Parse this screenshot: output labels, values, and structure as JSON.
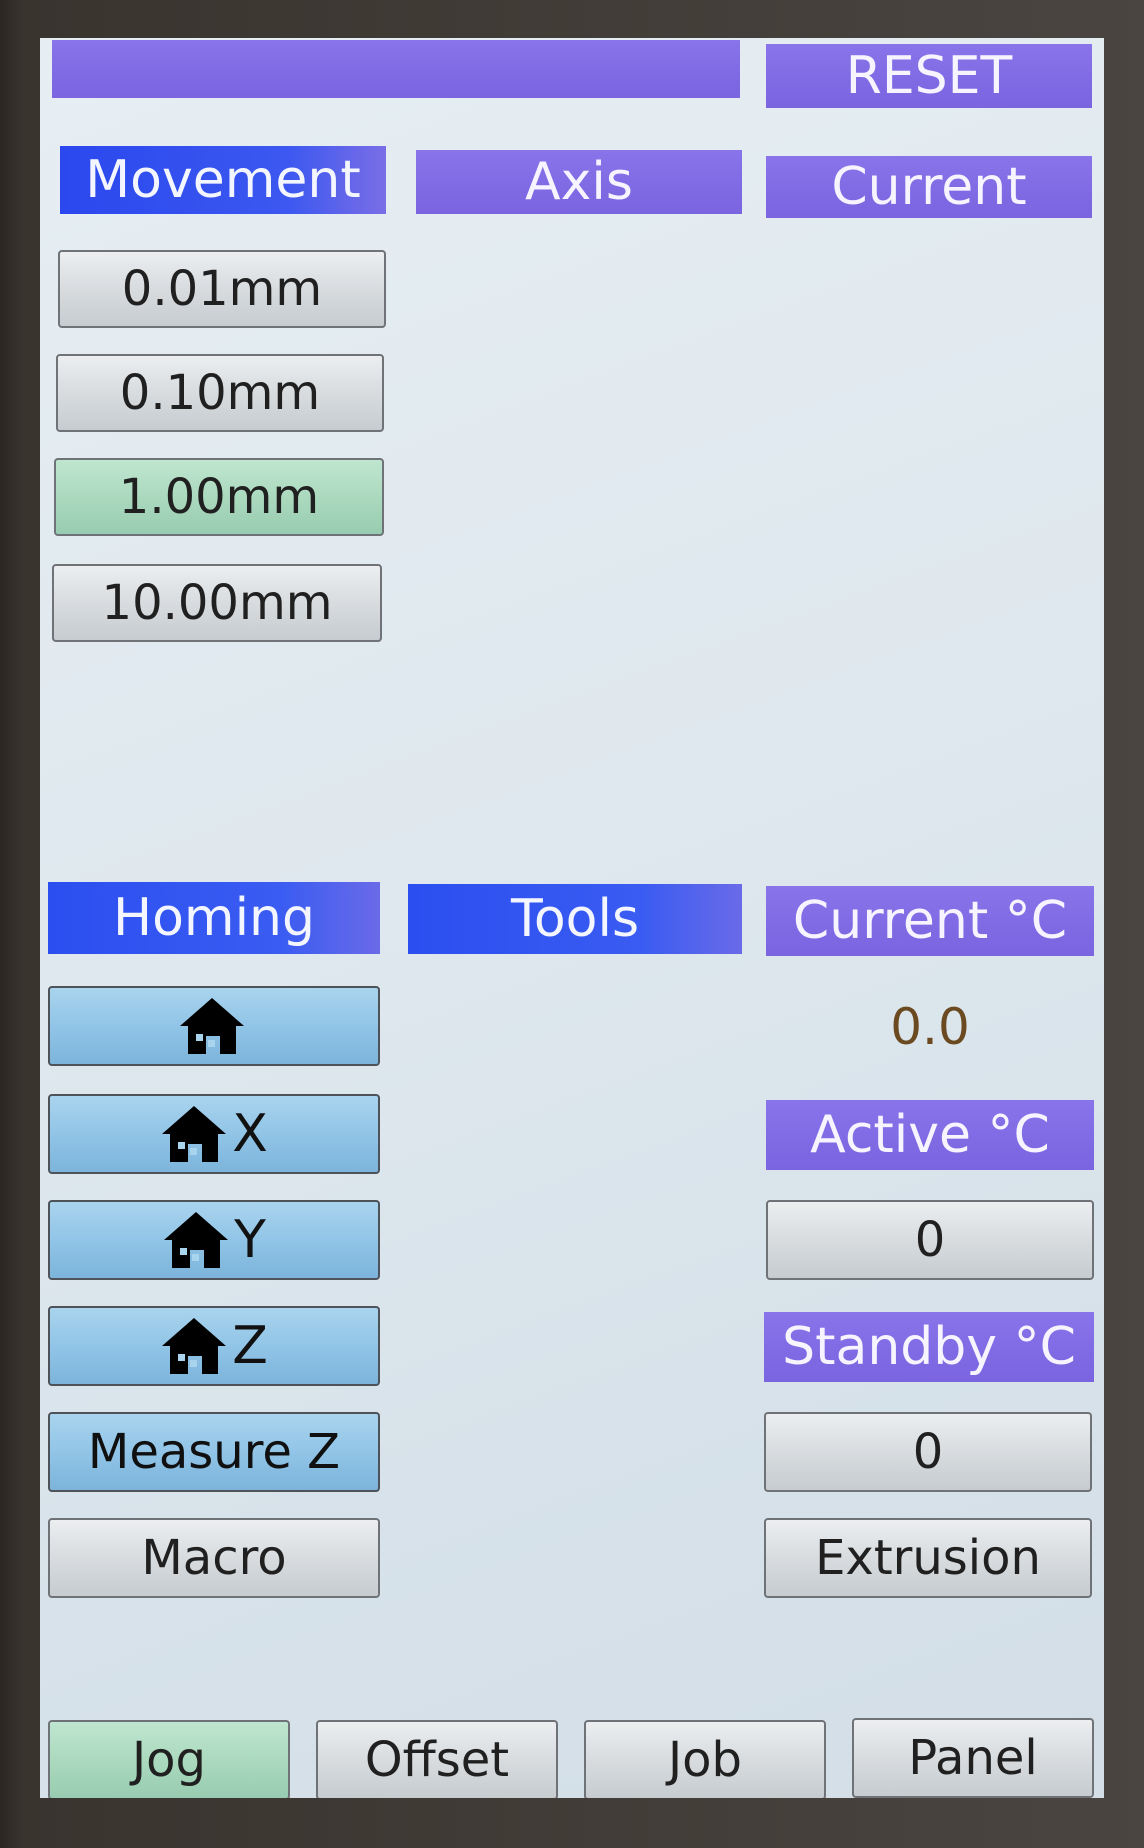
{
  "top": {
    "reset_label": "RESET"
  },
  "headers": {
    "movement": "Movement",
    "axis": "Axis",
    "current": "Current",
    "homing": "Homing",
    "tools": "Tools",
    "current_temp": "Current °C",
    "active_temp": "Active °C",
    "standby_temp": "Standby °C"
  },
  "movement_steps": [
    {
      "label": "0.01mm",
      "selected": false
    },
    {
      "label": "0.10mm",
      "selected": false
    },
    {
      "label": "1.00mm",
      "selected": true
    },
    {
      "label": "10.00mm",
      "selected": false
    }
  ],
  "homing": {
    "home_all_icon": "home-icon",
    "home_x": "X",
    "home_y": "Y",
    "home_z": "Z",
    "measure_z": "Measure  Z",
    "macro": "Macro"
  },
  "temps": {
    "current_value": "0.0",
    "active_value": "0",
    "standby_value": "0",
    "extrusion_label": "Extrusion"
  },
  "tabs": [
    {
      "label": "Jog",
      "active": true
    },
    {
      "label": "Offset",
      "active": false
    },
    {
      "label": "Job",
      "active": false
    },
    {
      "label": "Panel",
      "active": false
    }
  ],
  "colors": {
    "header_purple": "#7a64e0",
    "header_blue": "#2b4ef0",
    "selected_green": "#a9d8bd",
    "homing_blue": "#8fc3e6",
    "value_brown": "#6b4a22"
  }
}
